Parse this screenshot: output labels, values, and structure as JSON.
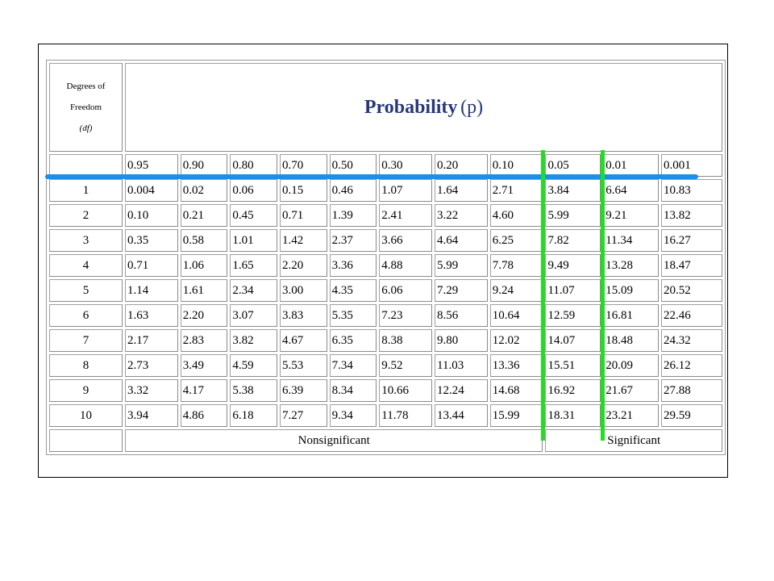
{
  "header": {
    "df_line1": "Degrees of",
    "df_line2": "Freedom",
    "df_line3": "(df)",
    "title_bold": "Probability",
    "title_italic": "(p)"
  },
  "probabilities": [
    "0.95",
    "0.90",
    "0.80",
    "0.70",
    "0.50",
    "0.30",
    "0.20",
    "0.10",
    "0.05",
    "0.01",
    "0.001"
  ],
  "rows": [
    {
      "df": "1",
      "values": [
        "0.004",
        "0.02",
        "0.06",
        "0.15",
        "0.46",
        "1.07",
        "1.64",
        "2.71",
        "3.84",
        "6.64",
        "10.83"
      ]
    },
    {
      "df": "2",
      "values": [
        "0.10",
        "0.21",
        "0.45",
        "0.71",
        "1.39",
        "2.41",
        "3.22",
        "4.60",
        "5.99",
        "9.21",
        "13.82"
      ]
    },
    {
      "df": "3",
      "values": [
        "0.35",
        "0.58",
        "1.01",
        "1.42",
        "2.37",
        "3.66",
        "4.64",
        "6.25",
        "7.82",
        "11.34",
        "16.27"
      ]
    },
    {
      "df": "4",
      "values": [
        "0.71",
        "1.06",
        "1.65",
        "2.20",
        "3.36",
        "4.88",
        "5.99",
        "7.78",
        "9.49",
        "13.28",
        "18.47"
      ]
    },
    {
      "df": "5",
      "values": [
        "1.14",
        "1.61",
        "2.34",
        "3.00",
        "4.35",
        "6.06",
        "7.29",
        "9.24",
        "11.07",
        "15.09",
        "20.52"
      ]
    },
    {
      "df": "6",
      "values": [
        "1.63",
        "2.20",
        "3.07",
        "3.83",
        "5.35",
        "7.23",
        "8.56",
        "10.64",
        "12.59",
        "16.81",
        "22.46"
      ]
    },
    {
      "df": "7",
      "values": [
        "2.17",
        "2.83",
        "3.82",
        "4.67",
        "6.35",
        "8.38",
        "9.80",
        "12.02",
        "14.07",
        "18.48",
        "24.32"
      ]
    },
    {
      "df": "8",
      "values": [
        "2.73",
        "3.49",
        "4.59",
        "5.53",
        "7.34",
        "9.52",
        "11.03",
        "13.36",
        "15.51",
        "20.09",
        "26.12"
      ]
    },
    {
      "df": "9",
      "values": [
        "3.32",
        "4.17",
        "5.38",
        "6.39",
        "8.34",
        "10.66",
        "12.24",
        "14.68",
        "16.92",
        "21.67",
        "27.88"
      ]
    },
    {
      "df": "10",
      "values": [
        "3.94",
        "4.86",
        "6.18",
        "7.27",
        "9.34",
        "11.78",
        "13.44",
        "15.99",
        "18.31",
        "23.21",
        "29.59"
      ]
    }
  ],
  "footer": {
    "nonsignificant": "Nonsignificant",
    "significant": "Significant"
  },
  "colors": {
    "title": "#283878",
    "highlight_row_line": "#1e8fe6",
    "highlight_column_lines": "#1fe01f"
  }
}
